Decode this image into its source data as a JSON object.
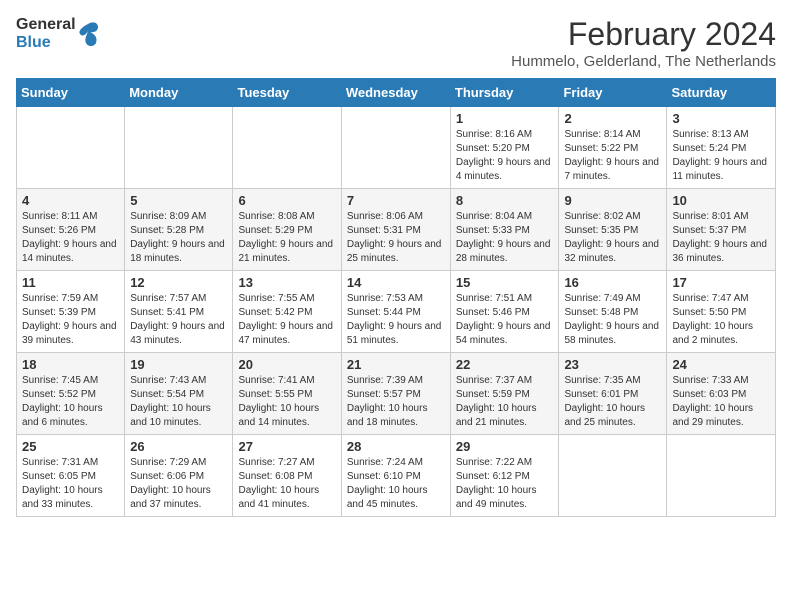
{
  "header": {
    "logo_general": "General",
    "logo_blue": "Blue",
    "month_title": "February 2024",
    "subtitle": "Hummelo, Gelderland, The Netherlands"
  },
  "weekdays": [
    "Sunday",
    "Monday",
    "Tuesday",
    "Wednesday",
    "Thursday",
    "Friday",
    "Saturday"
  ],
  "weeks": [
    [
      {
        "day": "",
        "info": ""
      },
      {
        "day": "",
        "info": ""
      },
      {
        "day": "",
        "info": ""
      },
      {
        "day": "",
        "info": ""
      },
      {
        "day": "1",
        "info": "Sunrise: 8:16 AM\nSunset: 5:20 PM\nDaylight: 9 hours and 4 minutes."
      },
      {
        "day": "2",
        "info": "Sunrise: 8:14 AM\nSunset: 5:22 PM\nDaylight: 9 hours and 7 minutes."
      },
      {
        "day": "3",
        "info": "Sunrise: 8:13 AM\nSunset: 5:24 PM\nDaylight: 9 hours and 11 minutes."
      }
    ],
    [
      {
        "day": "4",
        "info": "Sunrise: 8:11 AM\nSunset: 5:26 PM\nDaylight: 9 hours and 14 minutes."
      },
      {
        "day": "5",
        "info": "Sunrise: 8:09 AM\nSunset: 5:28 PM\nDaylight: 9 hours and 18 minutes."
      },
      {
        "day": "6",
        "info": "Sunrise: 8:08 AM\nSunset: 5:29 PM\nDaylight: 9 hours and 21 minutes."
      },
      {
        "day": "7",
        "info": "Sunrise: 8:06 AM\nSunset: 5:31 PM\nDaylight: 9 hours and 25 minutes."
      },
      {
        "day": "8",
        "info": "Sunrise: 8:04 AM\nSunset: 5:33 PM\nDaylight: 9 hours and 28 minutes."
      },
      {
        "day": "9",
        "info": "Sunrise: 8:02 AM\nSunset: 5:35 PM\nDaylight: 9 hours and 32 minutes."
      },
      {
        "day": "10",
        "info": "Sunrise: 8:01 AM\nSunset: 5:37 PM\nDaylight: 9 hours and 36 minutes."
      }
    ],
    [
      {
        "day": "11",
        "info": "Sunrise: 7:59 AM\nSunset: 5:39 PM\nDaylight: 9 hours and 39 minutes."
      },
      {
        "day": "12",
        "info": "Sunrise: 7:57 AM\nSunset: 5:41 PM\nDaylight: 9 hours and 43 minutes."
      },
      {
        "day": "13",
        "info": "Sunrise: 7:55 AM\nSunset: 5:42 PM\nDaylight: 9 hours and 47 minutes."
      },
      {
        "day": "14",
        "info": "Sunrise: 7:53 AM\nSunset: 5:44 PM\nDaylight: 9 hours and 51 minutes."
      },
      {
        "day": "15",
        "info": "Sunrise: 7:51 AM\nSunset: 5:46 PM\nDaylight: 9 hours and 54 minutes."
      },
      {
        "day": "16",
        "info": "Sunrise: 7:49 AM\nSunset: 5:48 PM\nDaylight: 9 hours and 58 minutes."
      },
      {
        "day": "17",
        "info": "Sunrise: 7:47 AM\nSunset: 5:50 PM\nDaylight: 10 hours and 2 minutes."
      }
    ],
    [
      {
        "day": "18",
        "info": "Sunrise: 7:45 AM\nSunset: 5:52 PM\nDaylight: 10 hours and 6 minutes."
      },
      {
        "day": "19",
        "info": "Sunrise: 7:43 AM\nSunset: 5:54 PM\nDaylight: 10 hours and 10 minutes."
      },
      {
        "day": "20",
        "info": "Sunrise: 7:41 AM\nSunset: 5:55 PM\nDaylight: 10 hours and 14 minutes."
      },
      {
        "day": "21",
        "info": "Sunrise: 7:39 AM\nSunset: 5:57 PM\nDaylight: 10 hours and 18 minutes."
      },
      {
        "day": "22",
        "info": "Sunrise: 7:37 AM\nSunset: 5:59 PM\nDaylight: 10 hours and 21 minutes."
      },
      {
        "day": "23",
        "info": "Sunrise: 7:35 AM\nSunset: 6:01 PM\nDaylight: 10 hours and 25 minutes."
      },
      {
        "day": "24",
        "info": "Sunrise: 7:33 AM\nSunset: 6:03 PM\nDaylight: 10 hours and 29 minutes."
      }
    ],
    [
      {
        "day": "25",
        "info": "Sunrise: 7:31 AM\nSunset: 6:05 PM\nDaylight: 10 hours and 33 minutes."
      },
      {
        "day": "26",
        "info": "Sunrise: 7:29 AM\nSunset: 6:06 PM\nDaylight: 10 hours and 37 minutes."
      },
      {
        "day": "27",
        "info": "Sunrise: 7:27 AM\nSunset: 6:08 PM\nDaylight: 10 hours and 41 minutes."
      },
      {
        "day": "28",
        "info": "Sunrise: 7:24 AM\nSunset: 6:10 PM\nDaylight: 10 hours and 45 minutes."
      },
      {
        "day": "29",
        "info": "Sunrise: 7:22 AM\nSunset: 6:12 PM\nDaylight: 10 hours and 49 minutes."
      },
      {
        "day": "",
        "info": ""
      },
      {
        "day": "",
        "info": ""
      }
    ]
  ]
}
